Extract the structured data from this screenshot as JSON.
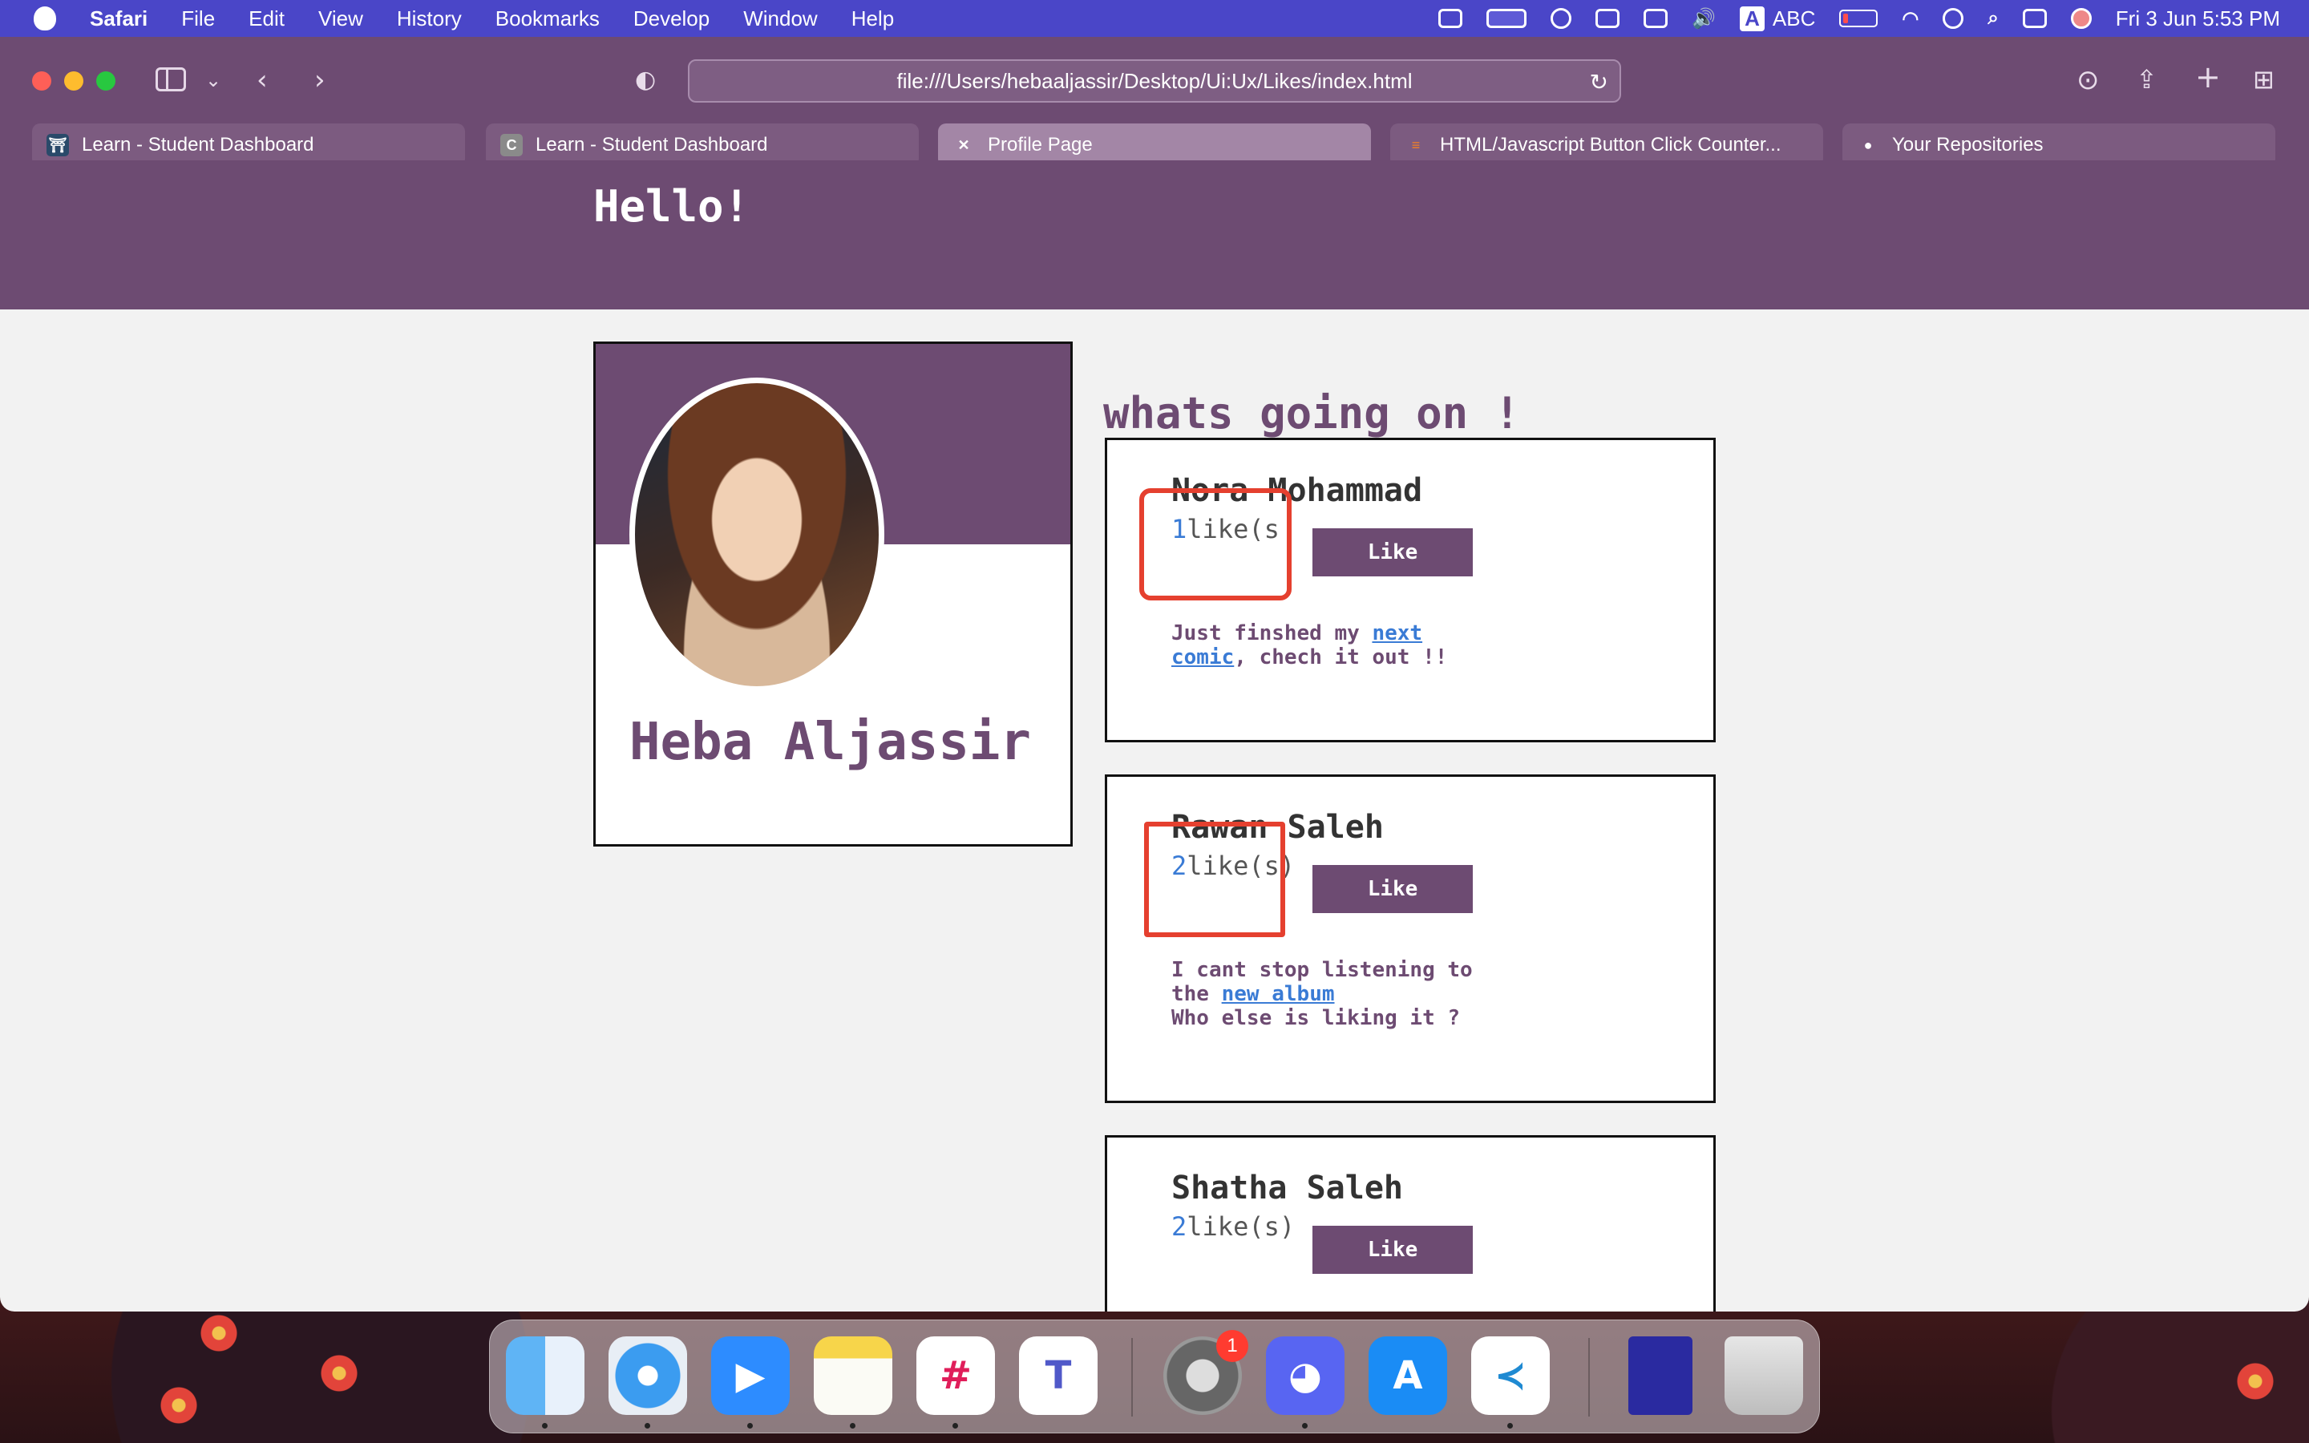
{
  "menubar": {
    "app_name": "Safari",
    "menus": [
      "File",
      "Edit",
      "View",
      "History",
      "Bookmarks",
      "Develop",
      "Window",
      "Help"
    ],
    "input_source": "ABC",
    "keyboard_badge": "A",
    "datetime": "Fri 3 Jun  5:53 PM"
  },
  "browser": {
    "url": "file:///Users/hebaaljassir/Desktop/Ui:Ux/Likes/index.html",
    "tabs": [
      {
        "label": "Learn - Student Dashboard",
        "favicon": "⛩",
        "active": false
      },
      {
        "label": "Learn - Student Dashboard",
        "favicon": "C",
        "active": false
      },
      {
        "label": "Profile Page",
        "favicon": "✕",
        "active": true
      },
      {
        "label": "HTML/Javascript Button Click Counter...",
        "favicon": "≡",
        "active": false
      },
      {
        "label": "Your Repositories",
        "favicon": "●",
        "active": false
      }
    ]
  },
  "page": {
    "header_greeting": "Hello!",
    "profile": {
      "name": "Heba Aljassir"
    },
    "feed_title": "whats going on !",
    "posts": [
      {
        "author": "Nora Mohammad",
        "like_count": "1",
        "like_suffix": "like(s",
        "button_label": "Like",
        "text_before": "Just finshed my ",
        "link_text": "next comic",
        "text_after": ", chech it out !!"
      },
      {
        "author": "Rawan Saleh",
        "like_count": "2",
        "like_suffix": "like(s)",
        "button_label": "Like",
        "text_before": "I cant stop listening to the ",
        "link_text": "new album",
        "text_after": "Who else is liking it ?"
      },
      {
        "author": "Shatha Saleh",
        "like_count": "2",
        "like_suffix": "like(s)",
        "button_label": "Like"
      }
    ]
  },
  "dock": {
    "apps": [
      "finder",
      "safari",
      "zoom",
      "notes",
      "slack",
      "teams",
      "system-preferences",
      "discord",
      "app-store",
      "vscode",
      "document",
      "trash"
    ],
    "system_preferences_badge": "1"
  },
  "colors": {
    "accent": "#6d4b72",
    "link": "#3a7bd5",
    "highlight": "#e5402f",
    "menubar": "#4a46c8"
  }
}
